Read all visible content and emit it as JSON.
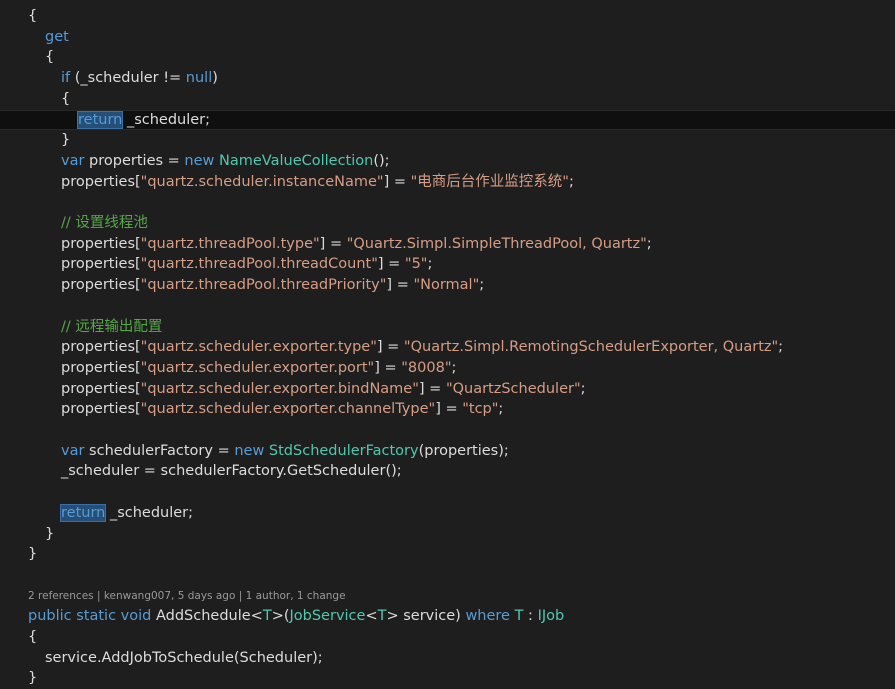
{
  "editor": {
    "code_lens": "2 references | kenwang007, 5 days ago | 1 author, 1 change",
    "lines": [
      {
        "indent": 28,
        "tokens": [
          [
            "p",
            "{"
          ]
        ]
      },
      {
        "indent": 45,
        "tokens": [
          [
            "k",
            "get"
          ]
        ]
      },
      {
        "indent": 45,
        "tokens": [
          [
            "p",
            "{"
          ]
        ]
      },
      {
        "indent": 61,
        "tokens": [
          [
            "k",
            "if"
          ],
          [
            "p",
            " (_scheduler != "
          ],
          [
            "k",
            "null"
          ],
          [
            "p",
            ")"
          ]
        ]
      },
      {
        "indent": 61,
        "tokens": [
          [
            "p",
            "{"
          ]
        ]
      },
      {
        "indent": 78,
        "current": true,
        "tokens": [
          [
            "k",
            "return",
            "hl"
          ],
          [
            "p",
            " _scheduler;"
          ]
        ]
      },
      {
        "indent": 61,
        "tokens": [
          [
            "p",
            "}"
          ]
        ]
      },
      {
        "indent": 61,
        "tokens": [
          [
            "k",
            "var"
          ],
          [
            "p",
            " properties = "
          ],
          [
            "k",
            "new"
          ],
          [
            "p",
            " "
          ],
          [
            "t",
            "NameValueCollection"
          ],
          [
            "p",
            "();"
          ]
        ]
      },
      {
        "indent": 61,
        "tokens": [
          [
            "p",
            "properties["
          ],
          [
            "s",
            "\"quartz.scheduler.instanceName\""
          ],
          [
            "p",
            "] = "
          ],
          [
            "s",
            "\"电商后台作业监控系统\""
          ],
          [
            "p",
            ";"
          ]
        ]
      },
      {
        "indent": 61,
        "tokens": []
      },
      {
        "indent": 61,
        "tokens": [
          [
            "c",
            "// 设置线程池"
          ]
        ]
      },
      {
        "indent": 61,
        "tokens": [
          [
            "p",
            "properties["
          ],
          [
            "s",
            "\"quartz.threadPool.type\""
          ],
          [
            "p",
            "] = "
          ],
          [
            "s",
            "\"Quartz.Simpl.SimpleThreadPool, Quartz\""
          ],
          [
            "p",
            ";"
          ]
        ]
      },
      {
        "indent": 61,
        "tokens": [
          [
            "p",
            "properties["
          ],
          [
            "s",
            "\"quartz.threadPool.threadCount\""
          ],
          [
            "p",
            "] = "
          ],
          [
            "s",
            "\"5\""
          ],
          [
            "p",
            ";"
          ]
        ]
      },
      {
        "indent": 61,
        "tokens": [
          [
            "p",
            "properties["
          ],
          [
            "s",
            "\"quartz.threadPool.threadPriority\""
          ],
          [
            "p",
            "] = "
          ],
          [
            "s",
            "\"Normal\""
          ],
          [
            "p",
            ";"
          ]
        ]
      },
      {
        "indent": 61,
        "tokens": []
      },
      {
        "indent": 61,
        "tokens": [
          [
            "c",
            "// 远程输出配置"
          ]
        ]
      },
      {
        "indent": 61,
        "tokens": [
          [
            "p",
            "properties["
          ],
          [
            "s",
            "\"quartz.scheduler.exporter.type\""
          ],
          [
            "p",
            "] = "
          ],
          [
            "s",
            "\"Quartz.Simpl.RemotingSchedulerExporter, Quartz\""
          ],
          [
            "p",
            ";"
          ]
        ]
      },
      {
        "indent": 61,
        "tokens": [
          [
            "p",
            "properties["
          ],
          [
            "s",
            "\"quartz.scheduler.exporter.port\""
          ],
          [
            "p",
            "] = "
          ],
          [
            "s",
            "\"8008\""
          ],
          [
            "p",
            ";"
          ]
        ]
      },
      {
        "indent": 61,
        "tokens": [
          [
            "p",
            "properties["
          ],
          [
            "s",
            "\"quartz.scheduler.exporter.bindName\""
          ],
          [
            "p",
            "] = "
          ],
          [
            "s",
            "\"QuartzScheduler\""
          ],
          [
            "p",
            ";"
          ]
        ]
      },
      {
        "indent": 61,
        "tokens": [
          [
            "p",
            "properties["
          ],
          [
            "s",
            "\"quartz.scheduler.exporter.channelType\""
          ],
          [
            "p",
            "] = "
          ],
          [
            "s",
            "\"tcp\""
          ],
          [
            "p",
            ";"
          ]
        ]
      },
      {
        "indent": 61,
        "tokens": []
      },
      {
        "indent": 61,
        "tokens": [
          [
            "k",
            "var"
          ],
          [
            "p",
            " schedulerFactory = "
          ],
          [
            "k",
            "new"
          ],
          [
            "p",
            " "
          ],
          [
            "t",
            "StdSchedulerFactory"
          ],
          [
            "p",
            "(properties);"
          ]
        ]
      },
      {
        "indent": 61,
        "tokens": [
          [
            "p",
            "_scheduler = schedulerFactory.GetScheduler();"
          ]
        ]
      },
      {
        "indent": 61,
        "tokens": []
      },
      {
        "indent": 61,
        "tokens": [
          [
            "k",
            "return",
            "hl"
          ],
          [
            "p",
            " _scheduler;"
          ]
        ]
      },
      {
        "indent": 45,
        "tokens": [
          [
            "p",
            "}"
          ]
        ]
      },
      {
        "indent": 28,
        "tokens": [
          [
            "p",
            "}"
          ]
        ]
      },
      {
        "indent": 28,
        "tokens": []
      },
      {
        "indent": 28,
        "lens": true,
        "tokens": []
      },
      {
        "indent": 28,
        "tokens": [
          [
            "k",
            "public"
          ],
          [
            "p",
            " "
          ],
          [
            "k",
            "static"
          ],
          [
            "p",
            " "
          ],
          [
            "k",
            "void"
          ],
          [
            "p",
            " AddSchedule<"
          ],
          [
            "t",
            "T"
          ],
          [
            "p",
            ">("
          ],
          [
            "t",
            "JobService"
          ],
          [
            "p",
            "<"
          ],
          [
            "t",
            "T"
          ],
          [
            "p",
            "> service) "
          ],
          [
            "k",
            "where"
          ],
          [
            "p",
            " "
          ],
          [
            "t",
            "T"
          ],
          [
            "p",
            " : "
          ],
          [
            "t",
            "IJob"
          ]
        ]
      },
      {
        "indent": 28,
        "tokens": [
          [
            "p",
            "{"
          ]
        ]
      },
      {
        "indent": 45,
        "tokens": [
          [
            "p",
            "service.AddJobToSchedule(Scheduler);"
          ]
        ]
      },
      {
        "indent": 28,
        "tokens": [
          [
            "p",
            "}"
          ]
        ]
      }
    ]
  }
}
